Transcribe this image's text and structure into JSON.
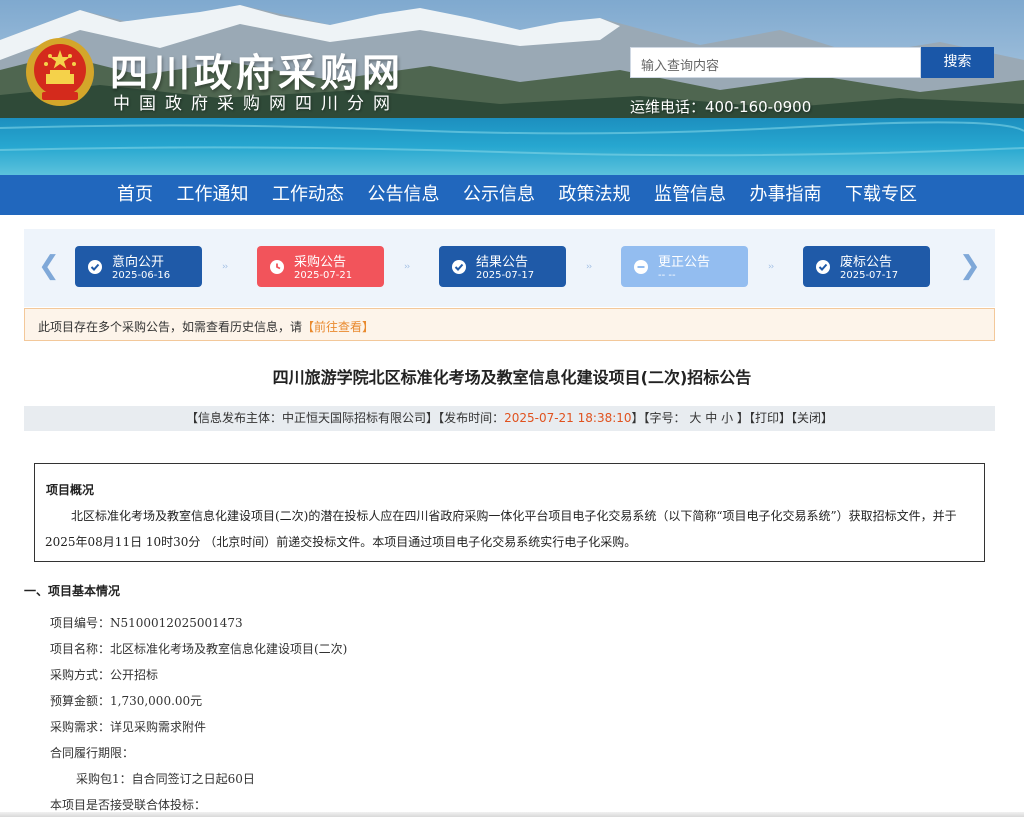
{
  "header": {
    "site_title": "四川政府采购网",
    "site_subtitle": "中国政府采购网四川分网",
    "search_placeholder": "输入查询内容",
    "search_button": "搜索",
    "hotline": "运维电话：400-160-0900"
  },
  "nav": {
    "items": [
      "首页",
      "工作通知",
      "工作动态",
      "公告信息",
      "公示信息",
      "政策法规",
      "监管信息",
      "办事指南",
      "下载专区"
    ]
  },
  "timeline": {
    "steps": [
      {
        "name": "意向公开",
        "date": "2025-06-16",
        "state": "done"
      },
      {
        "name": "采购公告",
        "date": "2025-07-21",
        "state": "current"
      },
      {
        "name": "结果公告",
        "date": "2025-07-17",
        "state": "done"
      },
      {
        "name": "更正公告",
        "date": "-- --",
        "state": "none"
      },
      {
        "name": "废标公告",
        "date": "2025-07-17",
        "state": "done"
      }
    ],
    "separator": "››"
  },
  "notice": {
    "text": "此项目存在多个采购公告，如需查看历史信息，请",
    "link": "【前往查看】"
  },
  "article": {
    "title": "四川旅游学院北区标准化考场及教室信息化建设项目(二次)招标公告",
    "meta": {
      "publisher_label": "【信息发布主体：",
      "publisher": "中正恒天国际招标有限公司",
      "publisher_end": "】",
      "time_label": "【发布时间：",
      "time": "2025-07-21 18:38:10",
      "time_end": "】",
      "font_label": "【字号：",
      "font_large": "大",
      "font_medium": "中",
      "font_small": "小",
      "font_end": "】",
      "print": "【打印】",
      "close": "【关闭】"
    }
  },
  "overview": {
    "title": "项目概况",
    "body": "北区标准化考场及教室信息化建设项目(二次)的潜在投标人应在四川省政府采购一体化平台项目电子化交易系统（以下简称“项目电子化交易系统”）获取招标文件，并于 2025年08月11日 10时30分 （北京时间）前递交投标文件。本项目通过项目电子化交易系统实行电子化采购。"
  },
  "basic_info": {
    "heading": "一、项目基本情况",
    "rows": [
      "项目编号：N5100012025001473",
      "项目名称：北区标准化考场及教室信息化建设项目(二次)",
      "采购方式：公开招标",
      "预算金额：1,730,000.00元",
      "采购需求：详见采购需求附件",
      "合同履行期限："
    ],
    "sub_row": "采购包1：自合同签订之日起60日",
    "last_row": "本项目是否接受联合体投标："
  },
  "colors": {
    "nav_blue": "#2167bd",
    "step_blue": "#1f5aa8",
    "step_red": "#f2545b",
    "step_light": "#93bdf0",
    "notice_link": "#e98a2f",
    "time_red": "#e0521f"
  }
}
